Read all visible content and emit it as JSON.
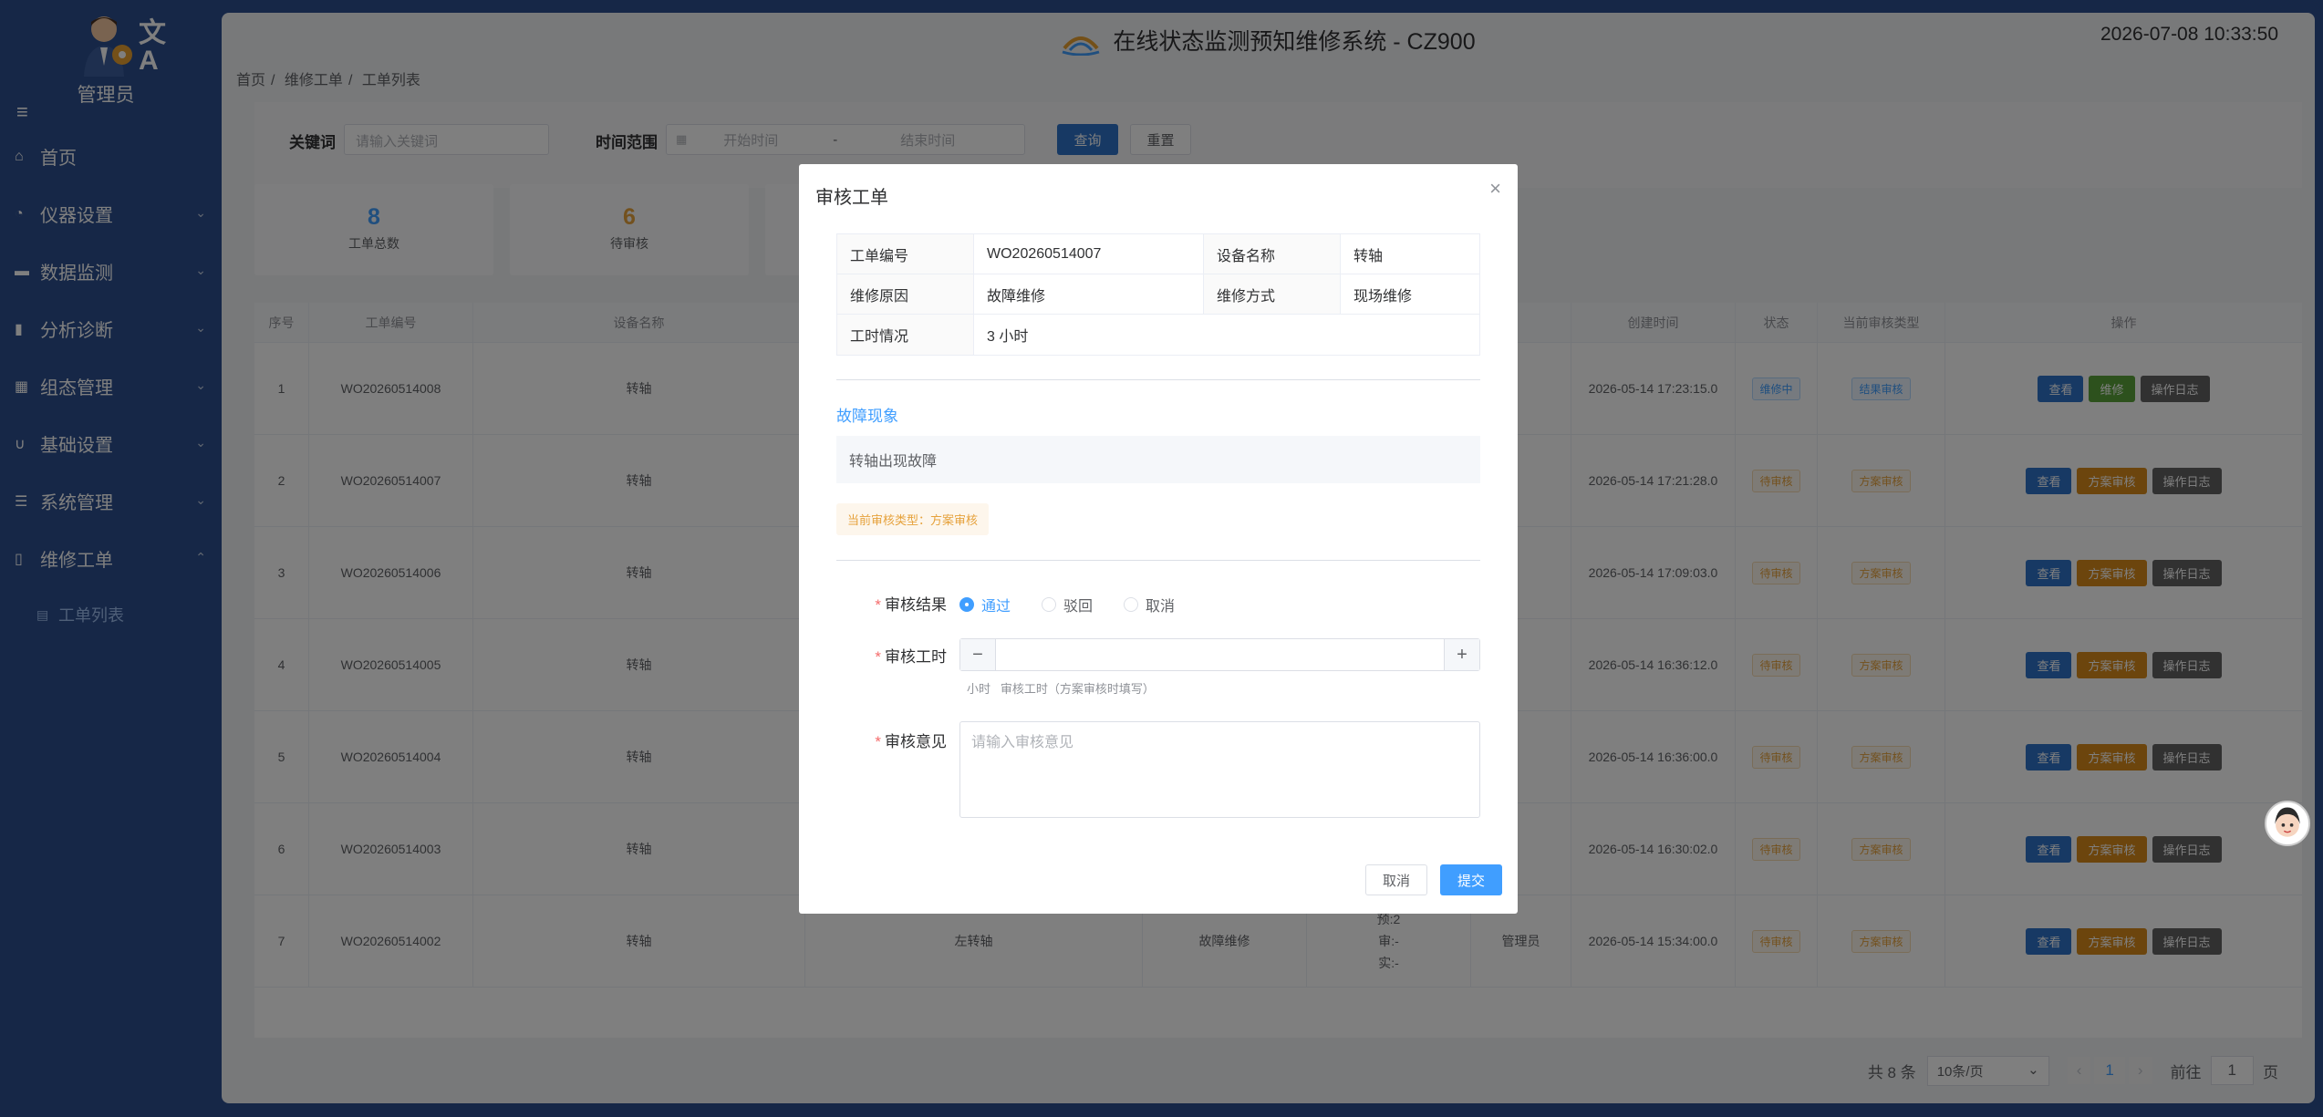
{
  "app": {
    "title": "在线状态监测预知维修系统 - CZ900",
    "clock": "2026-07-08 10:33:50"
  },
  "user": {
    "name": "管理员"
  },
  "sidebar": {
    "items": [
      {
        "label": "首页",
        "icon": "home-icon"
      },
      {
        "label": "仪器设置",
        "icon": "gauge-icon"
      },
      {
        "label": "数据监测",
        "icon": "monitor-icon"
      },
      {
        "label": "分析诊断",
        "icon": "bar-chart-icon"
      },
      {
        "label": "组态管理",
        "icon": "grid-icon"
      },
      {
        "label": "基础设置",
        "icon": "magnet-icon"
      },
      {
        "label": "系统管理",
        "icon": "sliders-icon"
      },
      {
        "label": "维修工单",
        "icon": "document-icon"
      }
    ],
    "subitems": [
      {
        "label": "工单列表",
        "icon": "clipboard-icon"
      }
    ]
  },
  "breadcrumb": [
    "首页",
    "维修工单",
    "工单列表"
  ],
  "filter": {
    "keyword_label": "关键词",
    "keyword_placeholder": "请输入关键词",
    "time_label": "时间范围",
    "start_placeholder": "开始时间",
    "sep": "-",
    "end_placeholder": "结束时间",
    "query": "查询",
    "reset": "重置"
  },
  "stats": [
    {
      "value": "8",
      "label": "工单总数"
    },
    {
      "value": "6",
      "label": "待审核"
    }
  ],
  "table": {
    "headers": [
      "序号",
      "工单编号",
      "设备名称",
      "",
      "",
      "",
      "",
      "创建时间",
      "状态",
      "当前审核类型",
      "操作"
    ],
    "rows": [
      {
        "no": "1",
        "id": "WO20260514008",
        "device": "转轴",
        "time": "2026-05-14 17:23:15.0",
        "status": "维修中",
        "review": "结果审核"
      },
      {
        "no": "2",
        "id": "WO20260514007",
        "device": "转轴",
        "time": "2026-05-14 17:21:28.0",
        "status": "待审核",
        "review": "方案审核"
      },
      {
        "no": "3",
        "id": "WO20260514006",
        "device": "转轴",
        "time": "2026-05-14 17:09:03.0",
        "status": "待审核",
        "review": "方案审核"
      },
      {
        "no": "4",
        "id": "WO20260514005",
        "device": "转轴",
        "time": "2026-05-14 16:36:12.0",
        "status": "待审核",
        "review": "方案审核"
      },
      {
        "no": "5",
        "id": "WO20260514004",
        "device": "转轴",
        "time": "2026-05-14 16:36:00.0",
        "status": "待审核",
        "review": "方案审核"
      },
      {
        "no": "6",
        "id": "WO20260514003",
        "device": "转轴",
        "time": "2026-05-14 16:30:02.0",
        "status": "待审核",
        "review": "方案审核"
      },
      {
        "no": "7",
        "id": "WO20260514002",
        "device": "转轴",
        "part": "左转轴",
        "reason": "故障维修",
        "hours": [
          "预:2",
          "审:-",
          "实:-"
        ],
        "creator": "管理员",
        "time": "2026-05-14 15:34:00.0",
        "status": "待审核",
        "review": "方案审核"
      }
    ],
    "actions": {
      "view": "查看",
      "repair": "维修",
      "plan_review": "方案审核",
      "log": "操作日志"
    }
  },
  "pager": {
    "total": "共 8 条",
    "page_size": "10条/页",
    "current": "1",
    "goto_label": "前往",
    "goto_value": "1",
    "page_unit": "页"
  },
  "modal": {
    "title": "审核工单",
    "details": [
      {
        "k1": "工单编号",
        "v1": "WO20260514007",
        "k2": "设备名称",
        "v2": "转轴"
      },
      {
        "k1": "维修原因",
        "v1": "故障维修",
        "k2": "维修方式",
        "v2": "现场维修"
      },
      {
        "k1": "工时情况",
        "v1": "3 小时"
      }
    ],
    "fault_title": "故障现象",
    "fault_text": "转轴出现故障",
    "review_type": "当前审核类型：方案审核",
    "result_label": "审核结果",
    "options": [
      "通过",
      "驳回",
      "取消"
    ],
    "selected": "通过",
    "hours_label": "审核工时",
    "hours_hint": "小时   审核工时（方案审核时填写）",
    "opinion_label": "审核意见",
    "opinion_placeholder": "请输入审核意见",
    "cancel": "取消",
    "submit": "提交"
  },
  "colors": {
    "primary": "#409eff",
    "sidebar": "#2d4f8e",
    "warning": "#e6a23c"
  }
}
